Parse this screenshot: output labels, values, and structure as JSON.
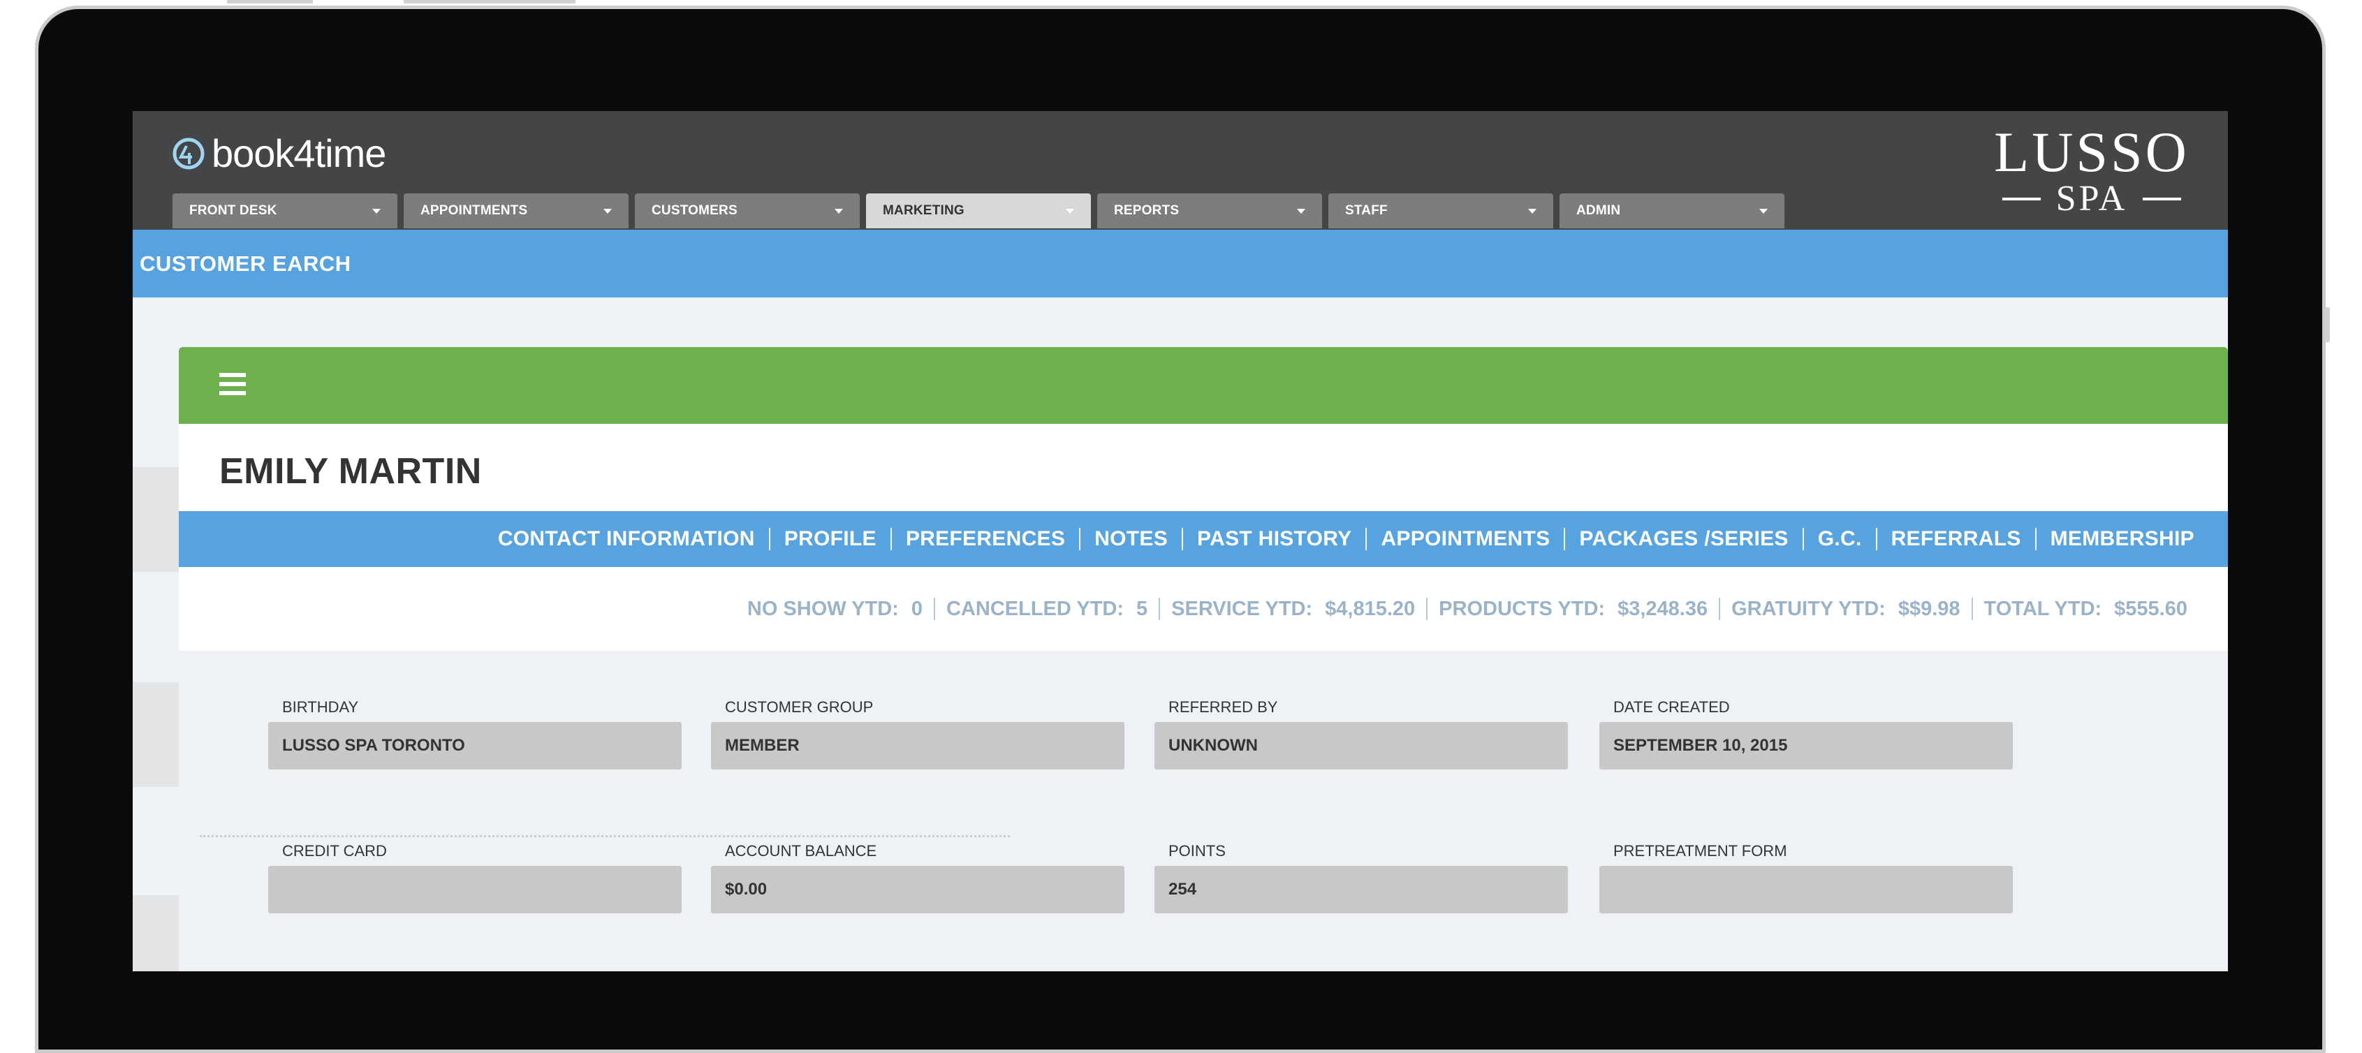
{
  "app": {
    "logo_text": "book4time",
    "brand_top": "LUSSO",
    "brand_bottom": "SPA"
  },
  "nav": {
    "items": [
      {
        "label": "FRONT DESK"
      },
      {
        "label": "APPOINTMENTS"
      },
      {
        "label": "CUSTOMERS"
      },
      {
        "label": "MARKETING"
      },
      {
        "label": "REPORTS"
      },
      {
        "label": "STAFF"
      },
      {
        "label": "ADMIN"
      }
    ],
    "active": "MARKETING"
  },
  "subbar": {
    "title": "CUSTOMER EARCH"
  },
  "customer": {
    "name": "EMILY MARTIN",
    "tabs": [
      {
        "label": "CONTACT INFORMATION"
      },
      {
        "label": "PROFILE"
      },
      {
        "label": "PREFERENCES"
      },
      {
        "label": "NOTES"
      },
      {
        "label": "PAST HISTORY"
      },
      {
        "label": "APPOINTMENTS"
      },
      {
        "label": "PACKAGES /SERIES"
      },
      {
        "label": "G.C."
      },
      {
        "label": "REFERRALS"
      },
      {
        "label": "MEMBERSHIP"
      }
    ],
    "stats": [
      {
        "label": "NO SHOW YTD:",
        "value": "0"
      },
      {
        "label": "CANCELLED YTD:",
        "value": "5"
      },
      {
        "label": "SERVICE YTD:",
        "value": "$4,815.20"
      },
      {
        "label": "PRODUCTS YTD:",
        "value": "$3,248.36"
      },
      {
        "label": "GRATUITY YTD:",
        "value": "$$9.98"
      },
      {
        "label": "TOTAL YTD:",
        "value": "$555.60"
      }
    ],
    "fields": {
      "birthday": {
        "label": "BIRTHDAY",
        "value": "LUSSO SPA TORONTO"
      },
      "customer_group": {
        "label": "CUSTOMER GROUP",
        "value": "MEMBER"
      },
      "referred_by": {
        "label": "REFERRED BY",
        "value": "UNKNOWN"
      },
      "date_created": {
        "label": "DATE CREATED",
        "value": "SEPTEMBER 10, 2015"
      },
      "credit_card": {
        "label": "CREDIT CARD",
        "value": ""
      },
      "account_balance": {
        "label": "ACCOUNT BALANCE",
        "value": "$0.00"
      },
      "points": {
        "label": "POINTS",
        "value": "254"
      },
      "pretreatment_form": {
        "label": "PRETREATMENT FORM",
        "value": ""
      }
    }
  },
  "colors": {
    "header": "#444546",
    "blue": "#57a3df",
    "green": "#6db14c",
    "field": "#c8c8c8"
  },
  "icons": {
    "logo": "book4time-logo-icon",
    "menu": "hamburger-menu-icon",
    "caret": "chevron-down-icon"
  }
}
